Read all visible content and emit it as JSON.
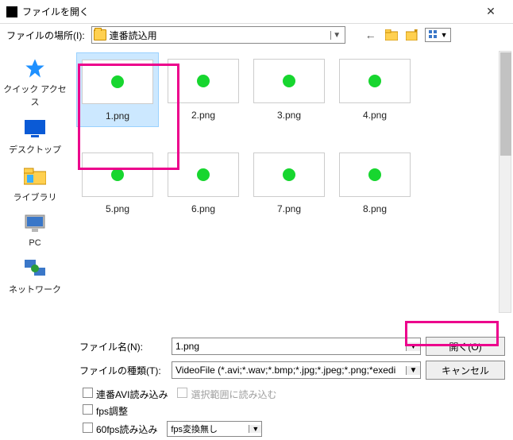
{
  "title": "ファイルを開く",
  "location": {
    "label": "ファイルの場所(I):",
    "value": "連番読込用"
  },
  "sidebar": {
    "items": [
      {
        "label": "クイック アクセス"
      },
      {
        "label": "デスクトップ"
      },
      {
        "label": "ライブラリ"
      },
      {
        "label": "PC"
      },
      {
        "label": "ネットワーク"
      }
    ]
  },
  "files": [
    {
      "name": "1.png",
      "selected": true
    },
    {
      "name": "2.png",
      "selected": false
    },
    {
      "name": "3.png",
      "selected": false
    },
    {
      "name": "4.png",
      "selected": false
    },
    {
      "name": "5.png",
      "selected": false
    },
    {
      "name": "6.png",
      "selected": false
    },
    {
      "name": "7.png",
      "selected": false
    },
    {
      "name": "8.png",
      "selected": false
    }
  ],
  "fileName": {
    "label": "ファイル名(N):",
    "value": "1.png"
  },
  "fileType": {
    "label": "ファイルの種類(T):",
    "value": "VideoFile (*.avi;*.wav;*.bmp;*.jpg;*.jpeg;*.png;*exedi"
  },
  "buttons": {
    "open": "開く(O)",
    "cancel": "キャンセル"
  },
  "options": {
    "renbanAvi": "連番AVI読み込み",
    "sentaku": "選択範囲に読み込む",
    "fpsAdjust": "fps調整",
    "fps60": "60fps読み込み",
    "fpsCombo": "fps変換無し"
  }
}
